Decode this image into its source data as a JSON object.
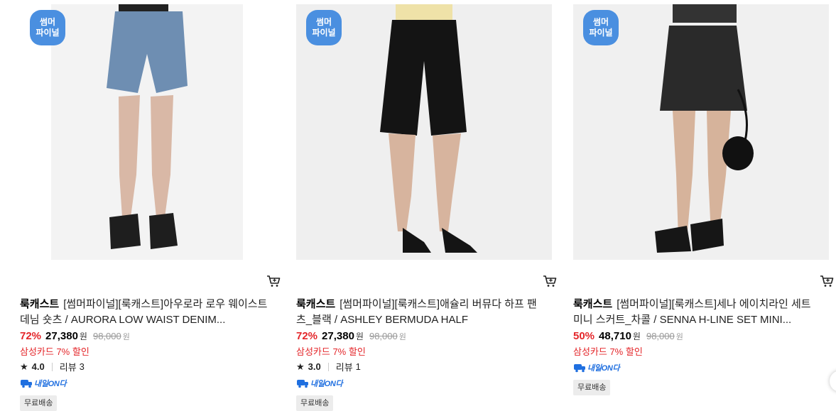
{
  "colors": {
    "accent": "#4a8fe0",
    "discount": "#e4262a",
    "delivery": "#1f6fe0"
  },
  "products": [
    {
      "badge": [
        "썸머",
        "파이널"
      ],
      "brand": "룩캐스트",
      "name": "[썸머파이널][룩캐스트]아우로라 로우 웨이스트 데님 숏츠 / AURORA LOW WAIST DENIM...",
      "discount": "72%",
      "price": "27,380",
      "won": "원",
      "original_price": "98,000",
      "card_discount": "삼성카드 7% 할인",
      "rating": "4.0",
      "review_label": "리뷰",
      "review_count": "3",
      "delivery": "내일ON다",
      "shipping": "무료배송"
    },
    {
      "badge": [
        "썸머",
        "파이널"
      ],
      "brand": "룩캐스트",
      "name": "[썸머파이널][룩캐스트]애슐리 버뮤다 하프 팬츠_블랙 / ASHLEY BERMUDA HALF PANTS_BLACK",
      "discount": "72%",
      "price": "27,380",
      "won": "원",
      "original_price": "98,000",
      "card_discount": "삼성카드 7% 할인",
      "rating": "3.0",
      "review_label": "리뷰",
      "review_count": "1",
      "delivery": "내일ON다",
      "shipping": "무료배송"
    },
    {
      "badge": [
        "썸머",
        "파이널"
      ],
      "brand": "룩캐스트",
      "name": "[썸머파이널][룩캐스트]세나 에이치라인 세트 미니 스커트_차콜 / SENNA H-LINE SET MINI...",
      "discount": "50%",
      "price": "48,710",
      "won": "원",
      "original_price": "98,000",
      "card_discount": "삼성카드 7% 할인",
      "delivery": "내일ON다",
      "shipping": "무료배송"
    }
  ]
}
